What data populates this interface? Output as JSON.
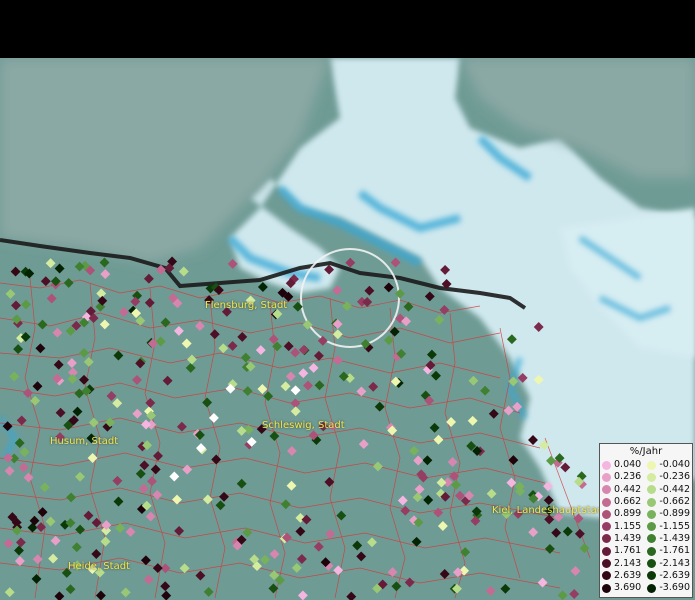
{
  "map": {
    "cities": [
      {
        "name": "Flensburg, Stadt"
      },
      {
        "name": "Schleswig, Stadt"
      },
      {
        "name": "Husum, Stadt"
      },
      {
        "name": "Kiel, Landeshauptstadt"
      },
      {
        "name": "Heide, Stadt"
      }
    ]
  },
  "legend": {
    "title": "%/Jahr",
    "positive": [
      {
        "value": "0.040",
        "color": "#f4b6e0"
      },
      {
        "value": "0.236",
        "color": "#e9a0c8"
      },
      {
        "value": "0.442",
        "color": "#d686af"
      },
      {
        "value": "0.662",
        "color": "#c46b94"
      },
      {
        "value": "0.899",
        "color": "#ad5279"
      },
      {
        "value": "1.155",
        "color": "#953d62"
      },
      {
        "value": "1.439",
        "color": "#7c2a4b"
      },
      {
        "value": "1.761",
        "color": "#631b37"
      },
      {
        "value": "2.143",
        "color": "#4c0f26"
      },
      {
        "value": "2.639",
        "color": "#350817"
      },
      {
        "value": "3.690",
        "color": "#1e030b"
      }
    ],
    "negative": [
      {
        "value": "-0.040",
        "color": "#eef7b0"
      },
      {
        "value": "-0.236",
        "color": "#d4eba0"
      },
      {
        "value": "-0.442",
        "color": "#b7dc8a"
      },
      {
        "value": "-0.662",
        "color": "#98c873"
      },
      {
        "value": "-0.899",
        "color": "#79b25c"
      },
      {
        "value": "-1.155",
        "color": "#5c9a46"
      },
      {
        "value": "-1.439",
        "color": "#408131"
      },
      {
        "value": "-1.761",
        "color": "#2a6820"
      },
      {
        "value": "-2.143",
        "color": "#185012"
      },
      {
        "value": "-2.639",
        "color": "#0c3908"
      },
      {
        "value": "-3.690",
        "color": "#042303"
      }
    ]
  }
}
